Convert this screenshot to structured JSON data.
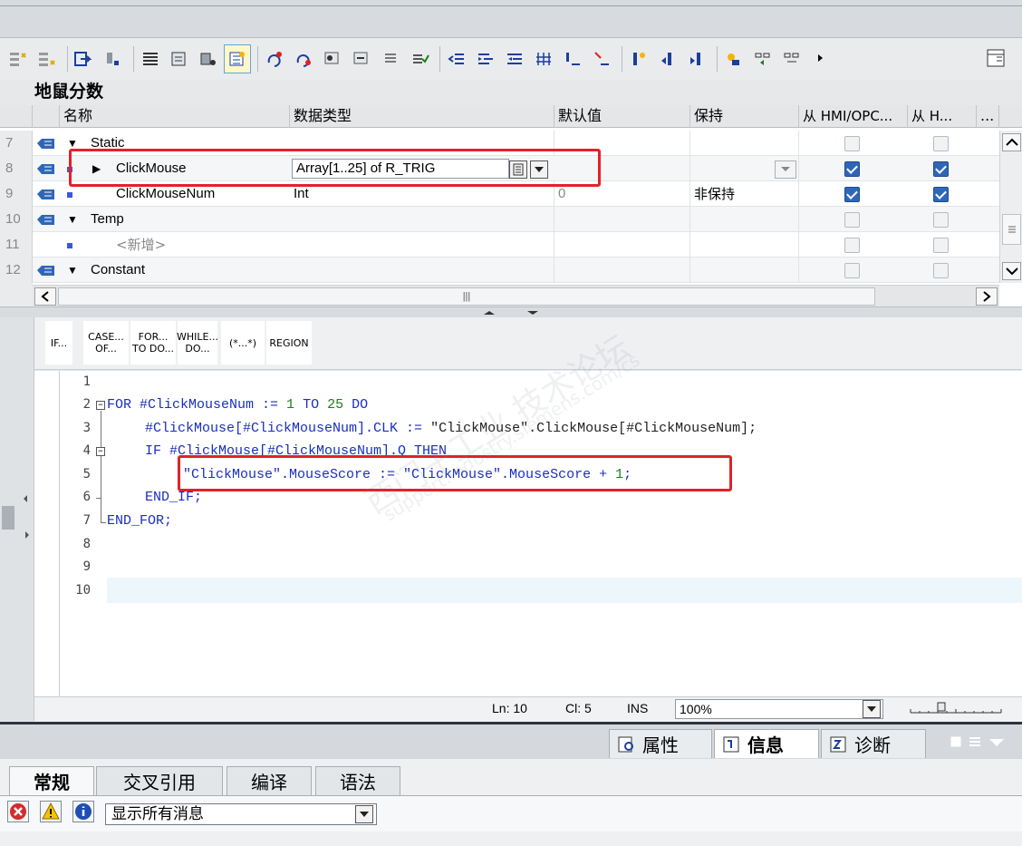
{
  "block": {
    "title": "地鼠分数"
  },
  "table": {
    "headers": {
      "name": "名称",
      "datatype": "数据类型",
      "default": "默认值",
      "retain": "保持",
      "hmi_access": "从 HMI/OPC...",
      "hmi_write": "从 H...",
      "more": "..."
    },
    "rows": [
      {
        "num": "7",
        "name": "Static",
        "datatype": "",
        "default": "",
        "retain": ""
      },
      {
        "num": "8",
        "name": "ClickMouse",
        "datatype": "Array[1..25] of R_TRIG",
        "default": "",
        "retain": ""
      },
      {
        "num": "9",
        "name": "ClickMouseNum",
        "datatype": "Int",
        "default": "0",
        "retain": "非保持"
      },
      {
        "num": "10",
        "name": "Temp",
        "datatype": "",
        "default": "",
        "retain": ""
      },
      {
        "num": "11",
        "name": "<新增>",
        "datatype": "",
        "default": "",
        "retain": ""
      },
      {
        "num": "12",
        "name": "Constant",
        "datatype": "",
        "default": "",
        "retain": ""
      }
    ],
    "hscroll_grip": "|||"
  },
  "keywords": {
    "if": "IF...",
    "case_1": "CASE...",
    "case_2": "OF...",
    "for_1": "FOR...",
    "for_2": "TO DO...",
    "while_1": "WHILE...",
    "while_2": "DO...",
    "comment": "(*...*)",
    "region": "REGION"
  },
  "code": {
    "line_numbers": [
      "1",
      "2",
      "3",
      "4",
      "5",
      "6",
      "7",
      "8",
      "9",
      "10"
    ],
    "l2_kw1": "FOR ",
    "l2_var": "#ClickMouseNum := ",
    "l2_n1": "1",
    "l2_kw2": " TO ",
    "l2_n2": "25",
    "l2_kw3": " DO",
    "l3_a": "#ClickMouse[#ClickMouseNum].CLK := ",
    "l3_b": "\"ClickMouse\".ClickMouse[#ClickMouseNum];",
    "l4": "IF #ClickMouse[#ClickMouseNum].Q THEN",
    "l5_a": "\"ClickMouse\".MouseScore := \"ClickMouse\".MouseScore + ",
    "l5_n": "1",
    "l5_end": ";",
    "l6": "END_IF;",
    "l7": "END_FOR;"
  },
  "status": {
    "ln": "Ln: 10",
    "cl": "Cl: 5",
    "mode": "INS",
    "zoom": "100%"
  },
  "inspector": {
    "tabs": [
      {
        "label": "属性"
      },
      {
        "label": "信息"
      },
      {
        "label": "诊断"
      }
    ],
    "subtabs": [
      "常规",
      "交叉引用",
      "编译",
      "语法"
    ],
    "filter": "显示所有消息"
  },
  "watermark": {
    "line1": "西门子工业  技术论坛",
    "line2": "support.industry.siemens.com/cs"
  },
  "colors": {
    "accent_blue": "#2f66b8",
    "highlight_red": "#e2212b",
    "keyword_blue": "#1a2fbd"
  }
}
